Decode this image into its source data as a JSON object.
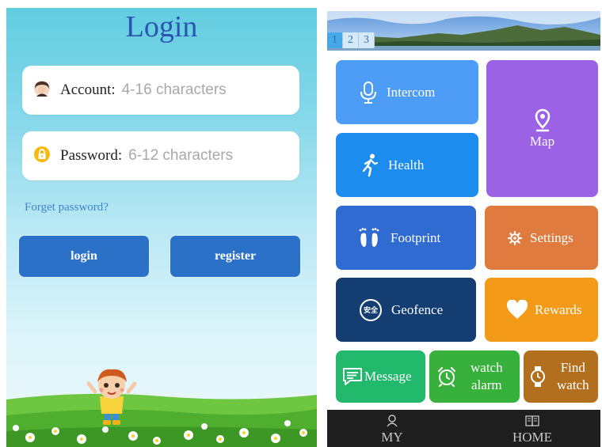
{
  "login": {
    "title": "Login",
    "account_label": "Account:",
    "account_placeholder": "4-16 characters",
    "password_label": "Password:",
    "password_placeholder": "6-12 characters",
    "forget_password": "Forget password?",
    "login_button": "login",
    "register_button": "register"
  },
  "home": {
    "banner_pages": [
      "1",
      "2",
      "3"
    ],
    "active_banner_page": "1",
    "tiles": {
      "intercom": "Intercom",
      "map": "Map",
      "health": "Health",
      "footprint": "Footprint",
      "settings": "Settings",
      "geofence": "Geofence",
      "geofence_badge": "安全",
      "rewards": "Rewards",
      "message": "Message",
      "watch_alarm_line1": "watch",
      "watch_alarm_line2": "alarm",
      "find_watch_line1": "Find",
      "find_watch_line2": "watch"
    },
    "nav": {
      "my": "MY",
      "home": "HOME"
    }
  },
  "colors": {
    "intercom": "#4d9cf5",
    "map": "#9b62e6",
    "health": "#1c8cef",
    "footprint": "#2f6bd0",
    "settings": "#e07b3f",
    "geofence": "#143d72",
    "rewards": "#f39a18",
    "message": "#22b96c",
    "watch_alarm": "#37b13b",
    "find_watch": "#b2701f",
    "nav_bar": "#1e1e1e",
    "login_button": "#2b71c7",
    "login_title": "#2a55b0"
  },
  "icons": {
    "account": "avatar-icon",
    "password": "lock-icon",
    "intercom": "microphone-icon",
    "map": "map-pin-icon",
    "health": "running-person-icon",
    "footprint": "footprint-icon",
    "settings": "gear-icon",
    "geofence": "shield-badge-icon",
    "rewards": "heart-icon",
    "message": "message-icon",
    "watch_alarm": "alarm-clock-icon",
    "find_watch": "watch-icon",
    "my": "person-icon",
    "home": "book-icon"
  }
}
